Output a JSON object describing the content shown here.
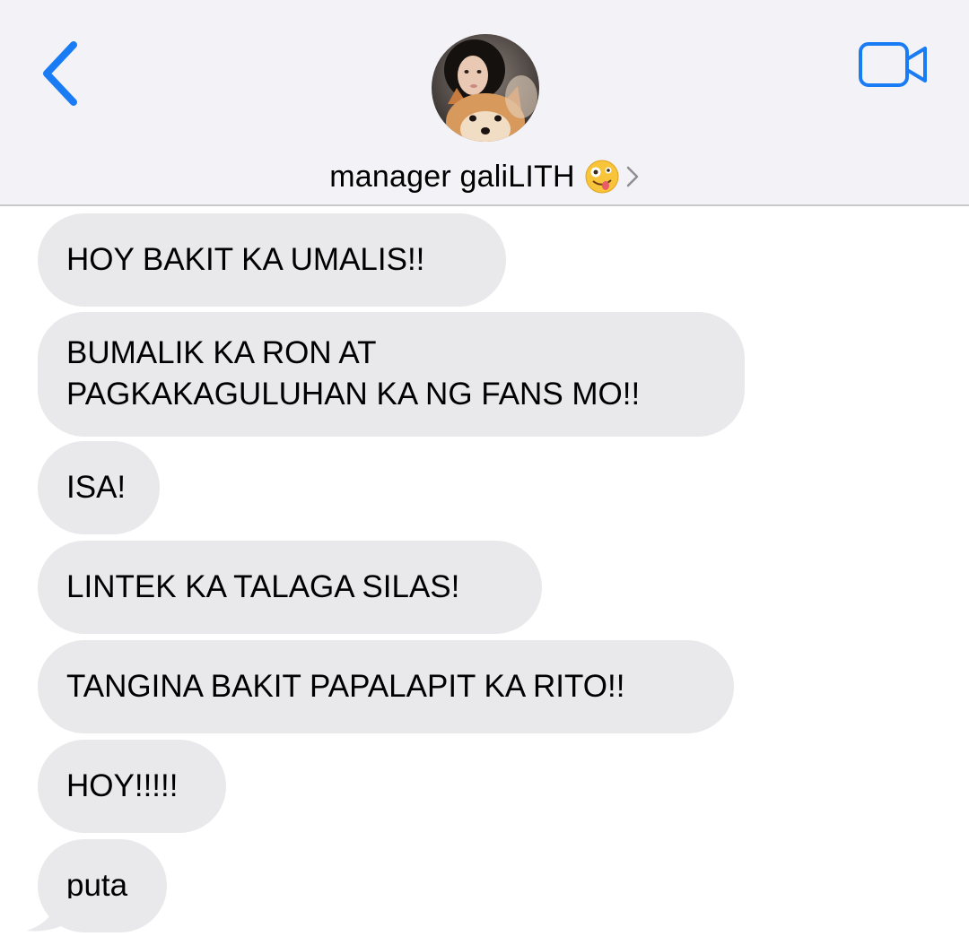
{
  "header": {
    "contact_name": "manager galiLITH",
    "back_icon": "chevron-left-icon",
    "video_icon": "video-camera-icon",
    "emoji_icon": "zany-face-emoji-icon",
    "accent_color": "#1a7cf5"
  },
  "messages": [
    {
      "text": "HOY BAKIT KA UMALIS!!"
    },
    {
      "text": "BUMALIK KA RON AT\nPAGKAKAGULUHAN KA NG FANS MO!!"
    },
    {
      "text": "ISA!"
    },
    {
      "text": "LINTEK KA TALAGA SILAS!"
    },
    {
      "text": "TANGINA BAKIT PAPALAPIT KA RITO!!"
    },
    {
      "text": "HOY!!!!!"
    },
    {
      "text": "puta"
    }
  ],
  "colors": {
    "header_bg": "#f2f2f7",
    "bubble_bg": "#e9e9eb"
  }
}
